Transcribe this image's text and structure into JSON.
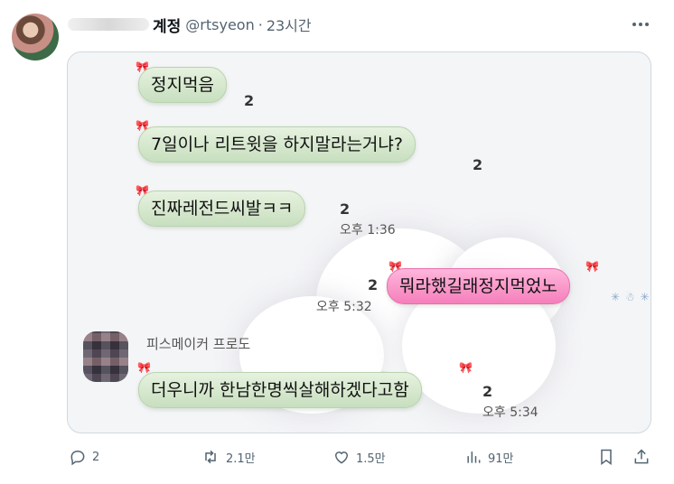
{
  "tweet": {
    "author_name_visible": "계정",
    "handle": "@rtsyeon",
    "separator": "·",
    "time": "23시간"
  },
  "chat": {
    "messages": [
      {
        "side": "left",
        "text": "정지먹음",
        "unread": "2",
        "time": ""
      },
      {
        "side": "left",
        "text": "7일이나 리트윗을 하지말라는거냐?",
        "unread": "2",
        "time": ""
      },
      {
        "side": "left",
        "text": "진짜레전드씨발ㅋㅋ",
        "unread": "2",
        "time": "오후 1:36"
      },
      {
        "side": "right",
        "text": "뭐라했길래정지먹었노",
        "unread": "2",
        "time": "오후 5:32"
      },
      {
        "side": "left",
        "text": "더우니까 한남한명씩살해하겠다고함",
        "unread": "2",
        "time": "오후 5:34"
      }
    ],
    "sender_name": "피스메이커 프로도"
  },
  "actions": {
    "reply": {
      "icon": "reply-icon",
      "count": "2"
    },
    "retweet": {
      "icon": "retweet-icon",
      "count": "2.1만"
    },
    "like": {
      "icon": "heart-icon",
      "count": "1.5만"
    },
    "views": {
      "icon": "views-icon",
      "count": "91만"
    },
    "bookmark": {
      "icon": "bookmark-icon"
    },
    "share": {
      "icon": "share-icon"
    }
  },
  "colors": {
    "secondary_text": "#536471",
    "green_bubble": "#d5e8cd",
    "pink_bubble": "#f78cc4",
    "border": "#cfd9de"
  }
}
